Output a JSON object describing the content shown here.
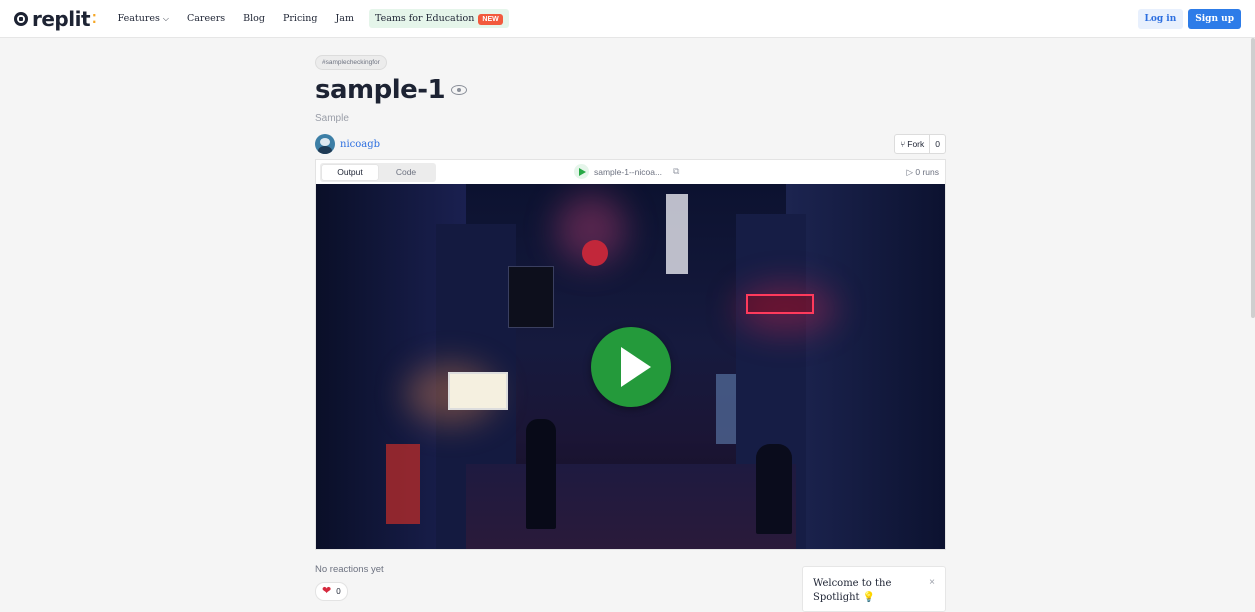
{
  "header": {
    "logo_text": "replit",
    "nav": [
      {
        "label": "Features",
        "has_dropdown": true
      },
      {
        "label": "Careers"
      },
      {
        "label": "Blog"
      },
      {
        "label": "Pricing"
      },
      {
        "label": "Jam"
      }
    ],
    "edu_label": "Teams for Education",
    "edu_badge": "NEW",
    "login_label": "Log in",
    "signup_label": "Sign up"
  },
  "repl": {
    "tag": "#samplecheckingfor",
    "title": "sample-1",
    "description": "Sample",
    "author": "nicoagb",
    "fork_label": "Fork",
    "fork_count": "0"
  },
  "player": {
    "tabs": [
      {
        "label": "Output",
        "active": true
      },
      {
        "label": "Code",
        "active": false
      }
    ],
    "run_name": "sample-1--nicoa...",
    "runs": "0 runs"
  },
  "reactions": {
    "empty_text": "No reactions yet",
    "heart_count": "0"
  },
  "spotlight": {
    "text": "Welcome to the Spotlight"
  },
  "colors": {
    "brand_blue": "#2d7ce8",
    "play_green": "#249a3b",
    "badge_new": "#f25a3d"
  }
}
